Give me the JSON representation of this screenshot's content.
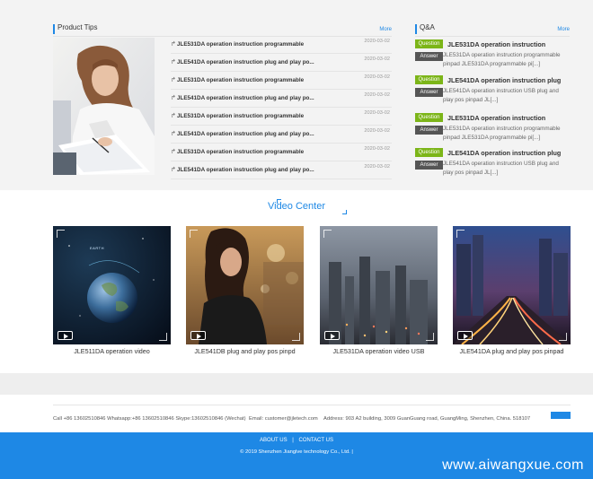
{
  "tips": {
    "title": "Product Tips",
    "more": "More",
    "items": [
      {
        "text": "JLE531DA operation instruction programmable",
        "date": "2020-03-02"
      },
      {
        "text": "JLE541DA operation instruction plug and play po...",
        "date": "2020-03-02"
      },
      {
        "text": "JLE531DA operation instruction programmable",
        "date": "2020-03-02"
      },
      {
        "text": "JLE541DA operation instruction plug and play po...",
        "date": "2020-03-02"
      },
      {
        "text": "JLE531DA operation instruction programmable",
        "date": "2020-03-02"
      },
      {
        "text": "JLE541DA operation instruction plug and play po...",
        "date": "2020-03-02"
      },
      {
        "text": "JLE531DA operation instruction programmable",
        "date": "2020-03-02"
      },
      {
        "text": "JLE541DA operation instruction plug and play po...",
        "date": "2020-03-02"
      }
    ]
  },
  "qa": {
    "title": "Q&A",
    "more": "More",
    "question_label": "Question",
    "answer_label": "Answer",
    "items": [
      {
        "q": "JLE531DA operation instruction",
        "a": "JLE531DA operation instruction programmable pinpad JLE531DA programmable pi[...]"
      },
      {
        "q": "JLE541DA operation instruction plug",
        "a": "JLE541DA operation instruction USB plug and play pos pinpad   JL[...]"
      },
      {
        "q": "JLE531DA operation instruction",
        "a": "JLE531DA operation instruction programmable pinpad JLE531DA programmable pi[...]"
      },
      {
        "q": "JLE541DA operation instruction plug",
        "a": "JLE541DA operation instruction USB plug and play pos pinpad   JL[...]"
      }
    ]
  },
  "video": {
    "title": "Video Center",
    "items": [
      {
        "label": "JLE511DA operation video",
        "thumb_caption": "EARTH"
      },
      {
        "label": "JLE541DB plug and play pos pinpd"
      },
      {
        "label": "JLE531DA operation video USB"
      },
      {
        "label": "JLE541DA plug and play pos pinpad"
      }
    ]
  },
  "contact": {
    "phone": "Call +86 13602510846 Whatsapp:+86 13602510846 Skype:13602510846 (Wechat)",
    "email": "Email: customer@jletech.com",
    "address": "Address: 903 A2 building, 3009 GuanGuang road, GuangMing, Shenzhen, China. 518107"
  },
  "footer": {
    "about": "ABOUT US",
    "contact": "CONTACT US",
    "separator": "|",
    "copyright": "© 2019 Shenzhen Jianglve technology Co., Ltd. |",
    "watermark": "www.aiwangxue.com"
  },
  "colors": {
    "accent": "#1e88e5",
    "question": "#7cb518",
    "answer": "#555555"
  }
}
